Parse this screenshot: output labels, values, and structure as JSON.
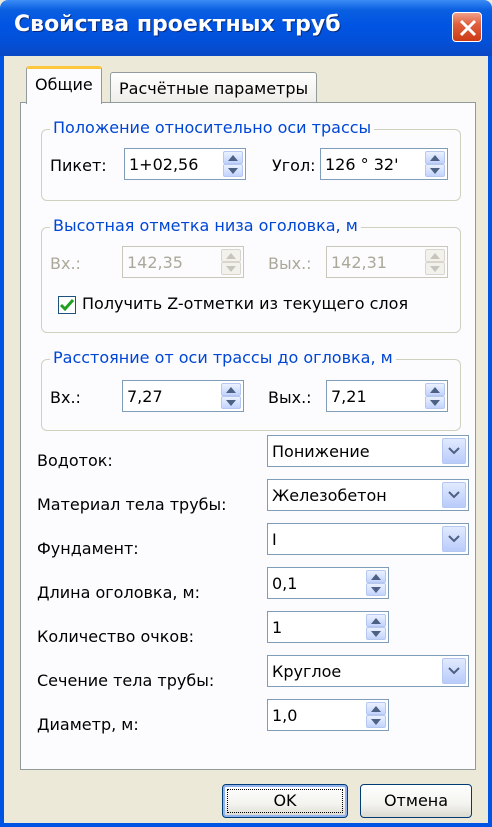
{
  "window": {
    "title": "Свойства проектных труб"
  },
  "tabs": [
    {
      "label": "Общие",
      "active": true
    },
    {
      "label": "Расчётные параметры",
      "active": false
    }
  ],
  "position_group": {
    "legend": "Положение относительно оси трассы",
    "picket_label": "Пикет:",
    "picket_value": "1+02,56",
    "angle_label": "Угол:",
    "angle_value": "126 ° 32'"
  },
  "elevation_group": {
    "legend": "Высотная отметка низа оголовка, м",
    "in_label": "Вх.:",
    "in_value": "142,35",
    "out_label": "Вых.:",
    "out_value": "142,31",
    "checkbox_label": "Получить Z-отметки из текущего слоя",
    "checkbox_checked": true
  },
  "distance_group": {
    "legend": "Расстояние от оси трассы до огловка, м",
    "in_label": "Вх.:",
    "in_value": "7,27",
    "out_label": "Вых.:",
    "out_value": "7,21"
  },
  "properties": {
    "watercourse_label": "Водоток:",
    "watercourse_value": "Понижение",
    "material_label": "Материал тела трубы:",
    "material_value": "Железобетон",
    "foundation_label": "Фундамент:",
    "foundation_value": "I",
    "head_length_label": "Длина оголовка, м:",
    "head_length_value": "0,1",
    "openings_label": "Количество очков:",
    "openings_value": "1",
    "section_label": "Сечение тела трубы:",
    "section_value": "Круглое",
    "diameter_label": "Диаметр, м:",
    "diameter_value": "1,0"
  },
  "buttons": {
    "ok": "OK",
    "cancel": "Отмена"
  },
  "colors": {
    "titlebar": "#0054e3",
    "legend_text": "#0046d5",
    "dialog_bg": "#ece9d8",
    "checkmark": "#21a121"
  }
}
